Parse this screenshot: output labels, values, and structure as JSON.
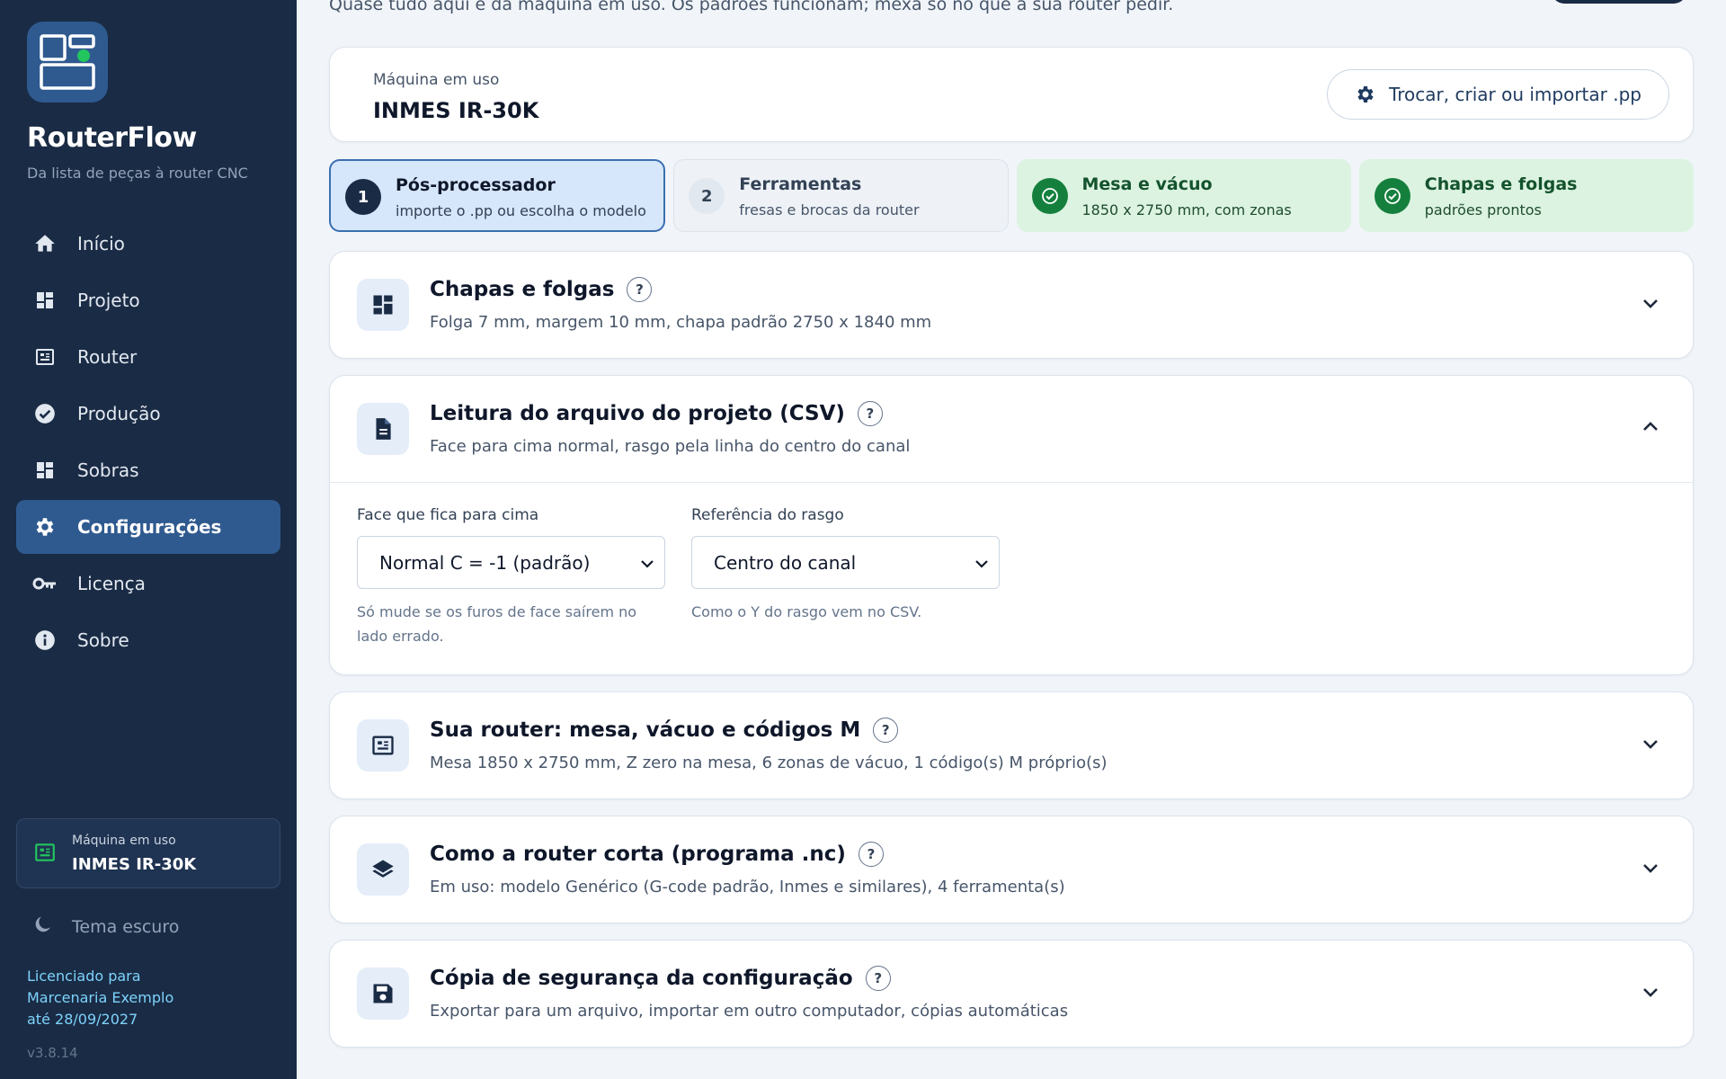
{
  "app": {
    "name": "RouterFlow",
    "tagline": "Da lista de peças à router CNC"
  },
  "nav": [
    {
      "label": "Início",
      "icon": "home-icon"
    },
    {
      "label": "Projeto",
      "icon": "dashboard-icon"
    },
    {
      "label": "Router",
      "icon": "router-icon"
    },
    {
      "label": "Produção",
      "icon": "check-circle-icon"
    },
    {
      "label": "Sobras",
      "icon": "dashboard-icon"
    },
    {
      "label": "Configurações",
      "icon": "gear-icon",
      "active": true
    },
    {
      "label": "Licença",
      "icon": "key-icon"
    },
    {
      "label": "Sobre",
      "icon": "info-icon"
    }
  ],
  "sidebar_machine": {
    "label": "Máquina em uso",
    "name": "INMES IR-30K"
  },
  "theme_toggle": "Tema escuro",
  "license": {
    "line1": "Licenciado para",
    "line2": "Marcenaria Exemplo",
    "line3": "até 28/09/2027"
  },
  "version": "v3.8.14",
  "intro": "Quase tudo aqui é da máquina em uso. Os padrões funcionam; mexa só no que a sua router pedir.",
  "machine_header": {
    "label": "Máquina em uso",
    "name": "INMES IR-30K",
    "switch_button": "Trocar, criar ou importar .pp"
  },
  "steps": [
    {
      "badge": "1",
      "title": "Pós-processador",
      "desc": "importe o .pp ou escolha o modelo",
      "state": "current"
    },
    {
      "badge": "2",
      "title": "Ferramentas",
      "desc": "fresas e brocas da router",
      "state": "pending"
    },
    {
      "badge": "",
      "title": "Mesa e vácuo",
      "desc": "1850 x 2750 mm, com zonas",
      "state": "done"
    },
    {
      "badge": "",
      "title": "Chapas e folgas",
      "desc": "padrões prontos",
      "state": "done"
    }
  ],
  "sections": [
    {
      "title": "Chapas e folgas",
      "desc": "Folga 7 mm, margem 10 mm, chapa padrão 2750 x 1840 mm",
      "icon": "dashboard-icon",
      "help": "?"
    },
    {
      "title": "Leitura do arquivo do projeto (CSV)",
      "desc": "Face para cima normal, rasgo pela linha do centro do canal",
      "icon": "document-icon",
      "help": "?"
    },
    {
      "title": "Sua router: mesa, vácuo e códigos M",
      "desc": "Mesa 1850 x 2750 mm, Z zero na mesa, 6 zonas de vácuo, 1 código(s) M próprio(s)",
      "icon": "router-icon",
      "help": "?"
    },
    {
      "title": "Como a router corta (programa .nc)",
      "desc": "Em uso: modelo Genérico (G-code padrão, Inmes e similares), 4 ferramenta(s)",
      "icon": "layers-icon",
      "help": "?"
    },
    {
      "title": "Cópia de segurança da configuração",
      "desc": "Exportar para um arquivo, importar em outro computador, cópias automáticas",
      "icon": "save-icon",
      "help": "?"
    }
  ],
  "csv_fields": {
    "face": {
      "label": "Face que fica para cima",
      "value": "Normal C = -1 (padrão)",
      "help": "Só mude se os furos de face saírem no lado errado."
    },
    "groove": {
      "label": "Referência do rasgo",
      "value": "Centro do canal",
      "help": "Como o Y do rasgo vem no CSV."
    }
  },
  "colors": {
    "sidebar_bg": "#1a2b45",
    "accent": "#2f5a8f",
    "success": "#15803d",
    "logo_dot": "#22c55e"
  }
}
